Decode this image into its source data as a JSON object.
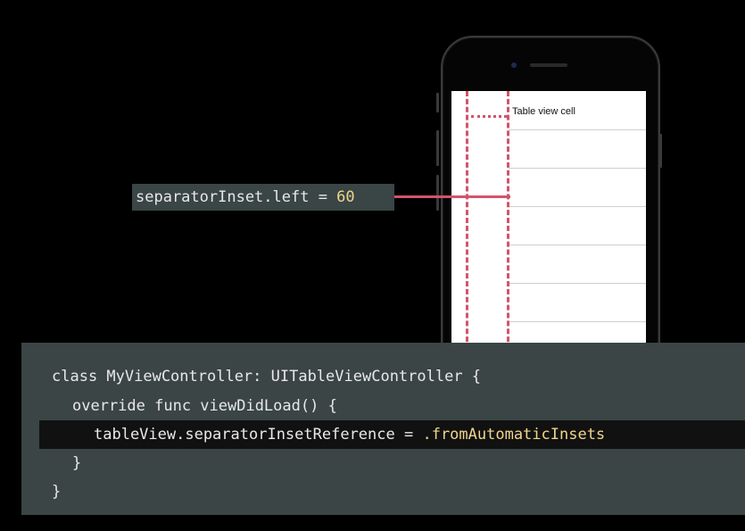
{
  "phone": {
    "cell_label": "Table view cell",
    "separator_rows": 6
  },
  "annotation": {
    "property": "separatorInset.left = ",
    "value": "60"
  },
  "code": {
    "line1": "class MyViewController: UITableViewController {",
    "line2": "override func viewDidLoad() {",
    "line3_prefix": "tableView.separatorInsetReference = ",
    "line3_value": ".fromAutomaticInsets",
    "line4": "}",
    "line5": "}"
  },
  "colors": {
    "accent": "#d2546b",
    "literal": "#f0d58b",
    "panel": "#3b4545"
  }
}
